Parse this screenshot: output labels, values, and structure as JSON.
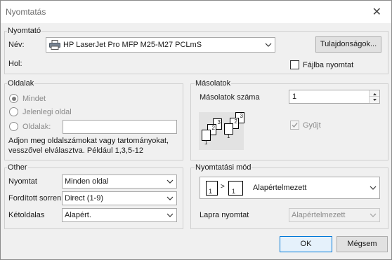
{
  "title": "Nyomtatás",
  "printer": {
    "group_label": "Nyomtató",
    "name_label": "Név:",
    "name_value": "HP LaserJet Pro MFP M25-M27 PCLmS",
    "properties_button": "Tulajdonságok...",
    "where_label": "Hol:",
    "print_to_file_label": "Fájlba nyomtat"
  },
  "pages": {
    "group_label": "Oldalak",
    "all_label": "Mindet",
    "current_label": "Jelenlegi oldal",
    "pages_label": "Oldalak:",
    "pages_value": "",
    "hint_line1": "Adjon meg oldalszámokat vagy tartományokat,",
    "hint_line2": "vesszővel elválasztva. Például 1,3,5-12"
  },
  "copies": {
    "group_label": "Másolatok",
    "count_label": "Másolatok száma",
    "count_value": "1",
    "collate_label": "Gyűjt",
    "stack_a": [
      "1",
      "2",
      "3"
    ],
    "stack_b": [
      "1",
      "2",
      "3"
    ]
  },
  "other": {
    "group_label": "Other",
    "print_label": "Nyomtat",
    "print_value": "Minden oldal",
    "order_label": "Fordított sorren",
    "order_value": "Direct (1-9)",
    "duplex_label": "Kétoldalas",
    "duplex_value": "Alapért."
  },
  "mode": {
    "group_label": "Nyomtatási mód",
    "mode_value": "Alapértelmezett",
    "sheet_from": "1",
    "sheet_to": "1",
    "sheet_print_label": "Lapra nyomtat",
    "sheet_print_value": "Alapértelmezett"
  },
  "buttons": {
    "ok": "OK",
    "cancel": "Mégsem"
  },
  "colors": {
    "accent": "#0078d7",
    "checkmark_disabled": "#9a9a9a"
  }
}
